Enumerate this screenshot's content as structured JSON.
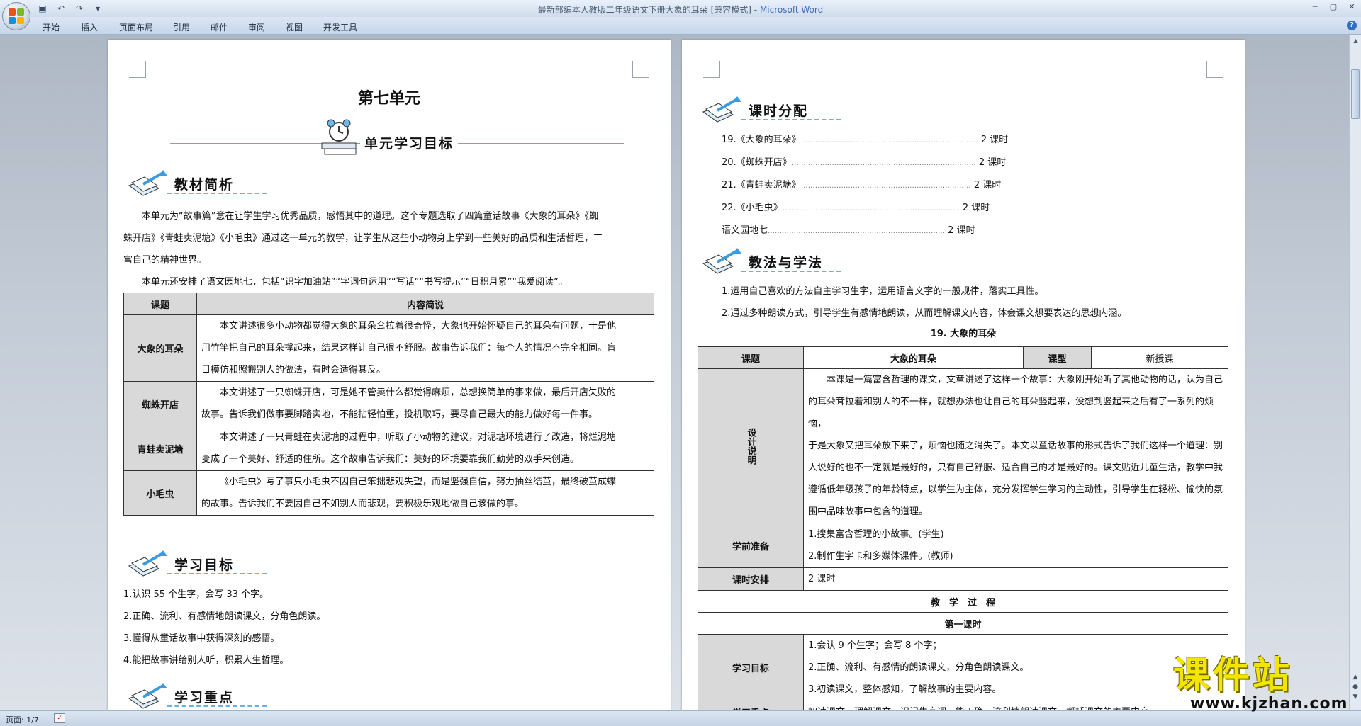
{
  "window": {
    "title": "最新部编本人教版二年级语文下册大象的耳朵 [兼容模式]",
    "app_name": "Microsoft Word"
  },
  "ribbon_tabs": [
    "开始",
    "插入",
    "页面布局",
    "引用",
    "邮件",
    "审阅",
    "视图",
    "开发工具"
  ],
  "status": {
    "page": "页面: 1/7"
  },
  "watermark": {
    "cn": "课件站",
    "url": "www.kjzhan.com"
  },
  "page1": {
    "unit_title": "第七单元",
    "banner": "单元学习目标",
    "s1_title": "教材简析",
    "p1_lines": [
      "本单元为“故事篇”意在让学生学习优秀品质，感悟其中的道理。这个专题选取了四篇童话故事《大象的耳朵》《蜘",
      "蛛开店》《青蛙卖泥塘》《小毛虫》通过这一单元的教学，让学生从这些小动物身上学到一些美好的品质和生活哲理，丰",
      "富自己的精神世界。"
    ],
    "p2": "本单元还安排了语文园地七，包括“识字加油站”“字词句运用”“写话”“书写提示”“日积月累”“我爱阅读”。",
    "table": {
      "headers": [
        "课题",
        "内容简说"
      ],
      "rows": [
        {
          "title": "大象的耳朵",
          "lines": [
            "本文讲述很多小动物都觉得大象的耳朵耷拉着很奇怪，大象也开始怀疑自己的耳朵有问题，于是他",
            "用竹竿把自己的耳朵撑起来，结果这样让自己很不舒服。故事告诉我们：每个人的情况不完全相同。盲",
            "目模仿和照搬别人的做法，有时会适得其反。"
          ]
        },
        {
          "title": "蜘蛛开店",
          "lines": [
            "本文讲述了一只蜘蛛开店，可是她不管卖什么都觉得麻烦，总想换简单的事来做，最后开店失败的",
            "故事。告诉我们做事要脚踏实地，不能拈轻怕重，投机取巧，要尽自己最大的能力做好每一件事。"
          ]
        },
        {
          "title": "青蛙卖泥塘",
          "lines": [
            "本文讲述了一只青蛙在卖泥塘的过程中，听取了小动物的建议，对泥塘环境进行了改造，将烂泥塘",
            "变成了一个美好、舒适的住所。这个故事告诉我们：美好的环境要靠我们勤劳的双手来创造。"
          ]
        },
        {
          "title": "小毛虫",
          "lines": [
            "《小毛虫》写了事只小毛虫不因自己笨拙悲观失望，而是坚强自信，努力抽丝结茧，最终破茧成蝶",
            "的故事。告诉我们不要因自己不如别人而悲观，要积极乐观地做自己该做的事。"
          ]
        }
      ]
    },
    "s2_title": "学习目标",
    "goals": [
      "1.认识 55 个生字，会写 33 个字。",
      "2.正确、流利、有感情地朗读课文，分角色朗读。",
      "3.懂得从童话故事中获得深刻的感悟。",
      "4.能把故事讲给别人听，积累人生哲理。"
    ],
    "s3_title": "学习重点"
  },
  "page2": {
    "s1_title": "课时分配",
    "schedule": [
      {
        "name": "19.《大象的耳朵》",
        "dots": "…………………………………………………………………",
        "hours": "2 课时"
      },
      {
        "name": "20.《蜘蛛开店》",
        "dots": "……………………………………………………………………",
        "hours": "2 课时"
      },
      {
        "name": "21.《青蛙卖泥塘》",
        "dots": "………………………………………………………………",
        "hours": "2 课时"
      },
      {
        "name": "22.《小毛虫》",
        "dots": "…………………………………………………………………",
        "hours": "2 课时"
      },
      {
        "name": "语文园地七",
        "dots": "…………………………………………………………………",
        "hours": "2 课时"
      }
    ],
    "s2_title": "教法与学法",
    "methods": [
      "1.运用自己喜欢的方法自主学习生字，运用语言文字的一般规律，落实工具性。",
      "2.通过多种朗读方式，引导学生有感情地朗读，从而理解课文内容，体会课文想要表达的思想内涵。"
    ],
    "lesson_title": "19. 大象的耳朵",
    "lt": {
      "h_topic": "课题",
      "topic": "大象的耳朵",
      "h_type": "课型",
      "type": "新授课",
      "h_design": "设计说明",
      "design_lines": [
        "本课是一篇富含哲理的课文，文章讲述了这样一个故事：大象刚开始听了其他动物的话，认为自己",
        "的耳朵耷拉着和别人的不一样，就想办法也让自己的耳朵竖起来，没想到竖起来之后有了一系列的烦恼，",
        "于是大象又把耳朵放下来了，烦恼也随之消失了。本文以童话故事的形式告诉了我们这样一个道理：别",
        "人说好的也不一定就是最好的，只有自己舒服、适合自己的才是最好的。课文贴近儿童生活，教学中我",
        "遵循低年级孩子的年龄特点，以学生为主体，充分发挥学生学习的主动性，引导学生在轻松、愉快的氛",
        "围中品味故事中包含的道理。"
      ],
      "h_prep": "学前准备",
      "prep": [
        "1.搜集富含哲理的小故事。(学生)",
        "2.制作生字卡和多媒体课件。(教师)"
      ],
      "h_time": "课时安排",
      "time": "2 课时",
      "process": "教　学　过　程",
      "first": "第一课时",
      "h_goal": "学习目标",
      "goals": [
        "1.会认 9 个生字；会写 8 个字；",
        "2.正确、流利、有感情的朗读课文，分角色朗读课文。",
        "3.初读课文，整体感知，了解故事的主要内容。"
      ],
      "h_key": "学习重点",
      "key": "初读课文，理解课文，识记生字词，能正确、流利地朗读课文，概括课文的主要内容。"
    }
  }
}
